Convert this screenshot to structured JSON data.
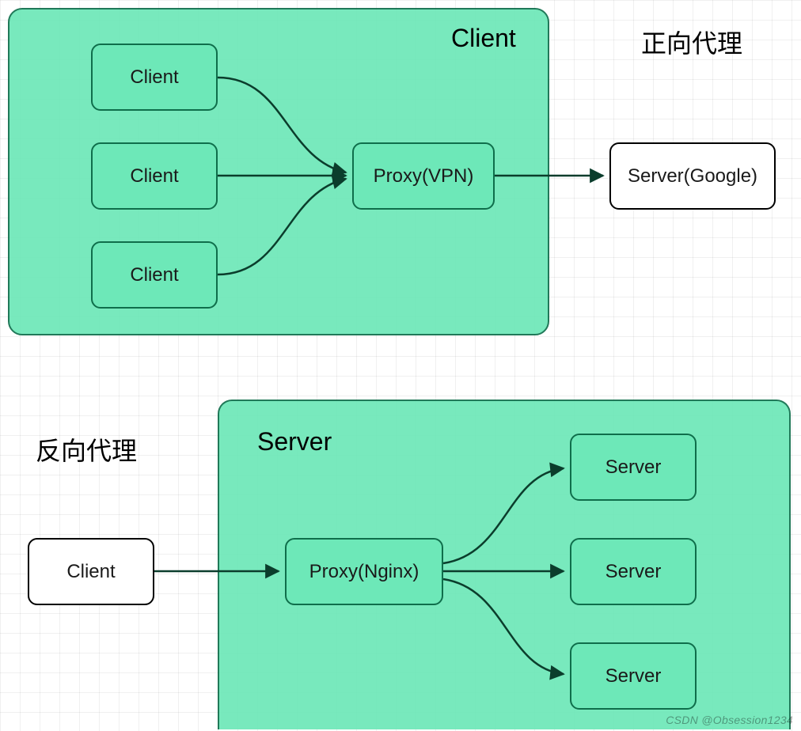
{
  "titles": {
    "forward_proxy": "正向代理",
    "reverse_proxy": "反向代理"
  },
  "regions": {
    "top_client_label": "Client",
    "bottom_server_label": "Server"
  },
  "top": {
    "client1": "Client",
    "client2": "Client",
    "client3": "Client",
    "proxy": "Proxy(VPN)",
    "server": "Server(Google)"
  },
  "bottom": {
    "client": "Client",
    "proxy": "Proxy(Nginx)",
    "server1": "Server",
    "server2": "Server",
    "server3": "Server"
  },
  "colors": {
    "region_fill": "#6de8b8",
    "region_border": "#0f6e4b",
    "node_border_dark": "#0f6e4b",
    "node_border_black": "#000000",
    "arrow": "#0b3d2c"
  },
  "watermark": "CSDN @Obsession1234"
}
